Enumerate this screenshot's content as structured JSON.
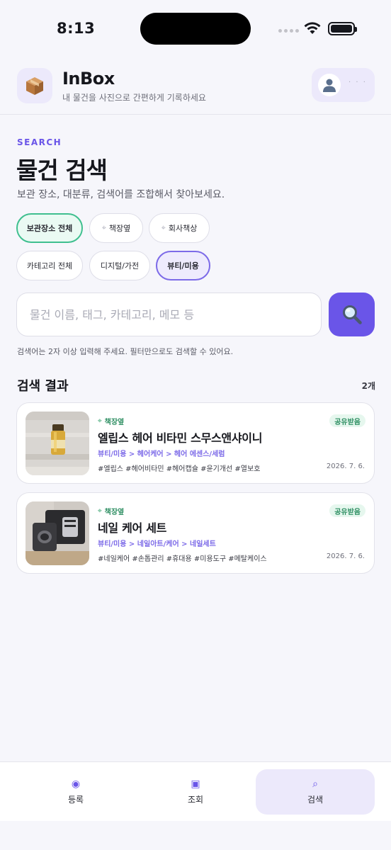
{
  "status_bar": {
    "time": "8:13"
  },
  "header": {
    "app_name": "InBox",
    "app_subtitle": "내 물건을 사진으로 간편하게 기록하세요",
    "logo_icon": "box-icon",
    "profile_name": "· · ·"
  },
  "search_section": {
    "eyebrow": "SEARCH",
    "title": "물건 검색",
    "description": "보관 장소, 대분류, 검색어를 조합해서 찾아보세요.",
    "location_filters": [
      {
        "label": "보관장소 전체",
        "selected": true
      },
      {
        "label": "책장옆",
        "selected": false,
        "icon": "pin-icon"
      },
      {
        "label": "회사책상",
        "selected": false,
        "icon": "pin-icon"
      }
    ],
    "category_filters": [
      {
        "label": "카테고리 전체",
        "selected": false
      },
      {
        "label": "디지털/가전",
        "selected": false
      },
      {
        "label": "뷰티/미용",
        "selected": true
      }
    ],
    "search_placeholder": "물건 이름, 태그, 카테고리, 메모 등",
    "search_value": "",
    "hint": "검색어는 2자 이상 입력해 주세요. 필터만으로도 검색할 수 있어요."
  },
  "results": {
    "title": "검색 결과",
    "count": "2개",
    "items": [
      {
        "location": "책장옆",
        "badge": "공유받음",
        "name": "엘립스 헤어 비타민 스무스앤샤이니",
        "category_path": "뷰티/미용 > 헤어케어 > 헤어 에센스/세럼",
        "tags": "#엘립스 #헤어비타민 #헤어캡슐 #윤기개선 #열보호",
        "date": "2026. 7. 6."
      },
      {
        "location": "책장옆",
        "badge": "공유받음",
        "name": "네일 케어 세트",
        "category_path": "뷰티/미용 > 네일아트/케어 > 네일세트",
        "tags": "#네일케어 #손톱관리 #휴대용 #미용도구 #메탈케이스",
        "date": "2026. 7. 6."
      }
    ]
  },
  "bottom_nav": [
    {
      "label": "등록",
      "icon": "◉",
      "active": false
    },
    {
      "label": "조회",
      "icon": "▣",
      "active": false
    },
    {
      "label": "검색",
      "icon": "⌕",
      "active": true
    }
  ],
  "colors": {
    "accent": "#6a55e8",
    "green": "#3fbf8f",
    "background": "#f6f6fb"
  }
}
